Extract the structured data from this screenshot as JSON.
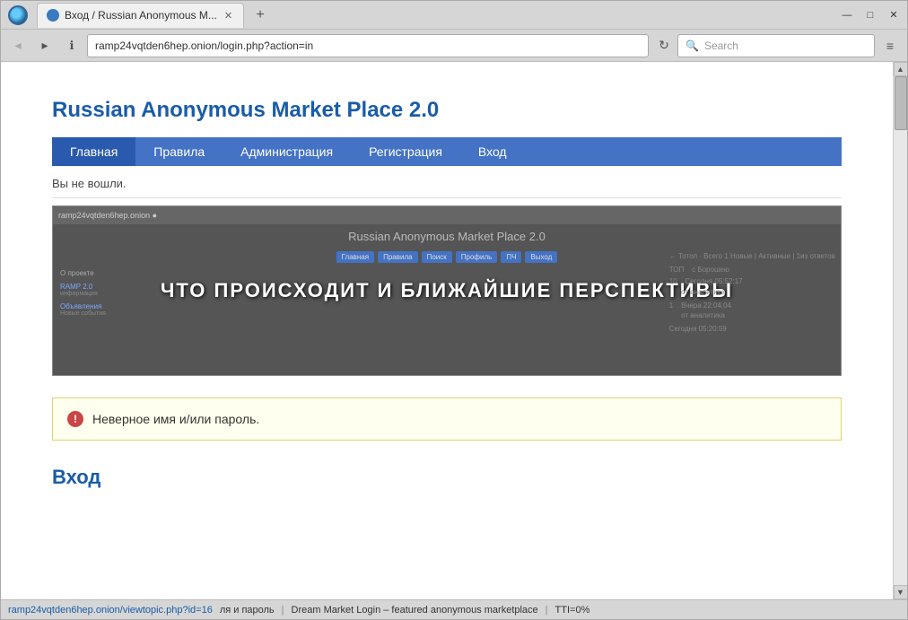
{
  "window": {
    "title": "Вход / Russian Anonymous M...",
    "minimize": "—",
    "maximize": "□",
    "close": "✕"
  },
  "tab": {
    "label": "Вход / Russian Anonymous M...",
    "close": "✕"
  },
  "new_tab_btn": "+",
  "nav": {
    "back_arrow": "‹",
    "forward_arrow": "›",
    "info_icon": "ℹ",
    "address": "ramp24vqtden6hep.onion/login.php?action=in",
    "refresh": "↻",
    "search_placeholder": "Search",
    "menu": "≡"
  },
  "site": {
    "title": "Russian Anonymous Market Place 2.0",
    "nav_items": [
      {
        "label": "Главная",
        "active": true
      },
      {
        "label": "Правила"
      },
      {
        "label": "Администрация"
      },
      {
        "label": "Регистрация"
      },
      {
        "label": "Вход"
      }
    ],
    "not_logged_in_text": "Вы не вошли.",
    "banner_title": "Russian Anonymous Market Place 2.0",
    "banner_overlay": "ЧТО ПРОИСХОДИТ И БЛИЖАЙШИЕ ПЕРСПЕКТИВЫ",
    "banner_nav": [
      "Главная",
      "Правила",
      "Поиск",
      "Профиль",
      "ПЧ",
      "Выход"
    ],
    "banner_top": "ramp24vqtden6hep.onion ●",
    "error_message": "Неверное имя и/или пароль.",
    "login_heading": "Вход"
  },
  "status_bar": {
    "left": "ramp24vqtden6hep.onion/viewtopic.php?id=16",
    "middle": "ля и пароль",
    "separator1": "Dream Market Login – featured anonymous marketplace",
    "separator2": "TTI=0%"
  },
  "scrollbar": {
    "up": "▲",
    "down": "▼"
  }
}
